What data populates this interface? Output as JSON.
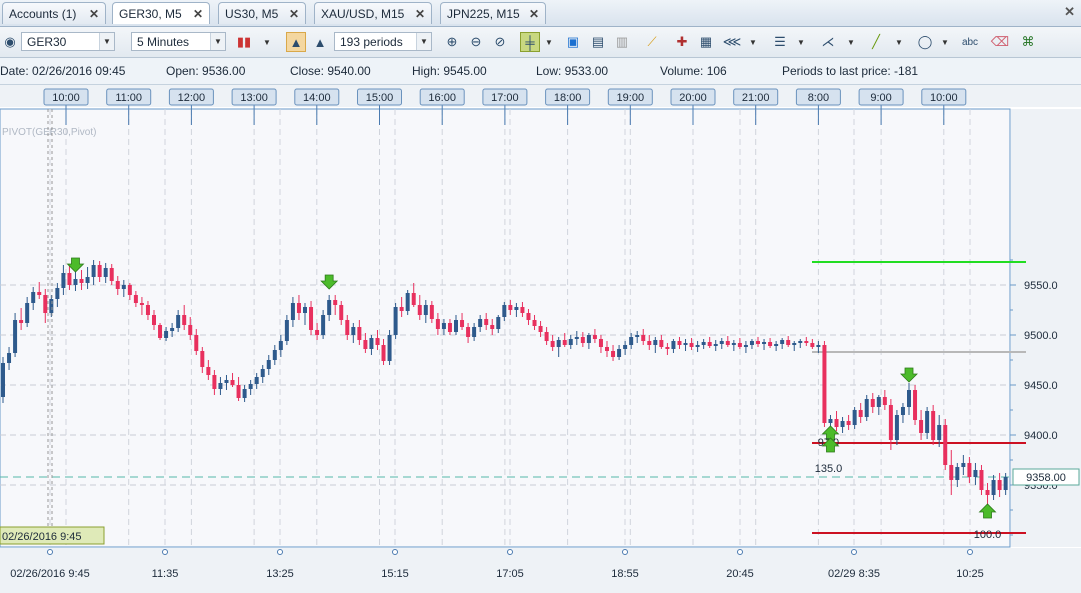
{
  "tabs": [
    {
      "label": "Accounts (1)"
    },
    {
      "label": "GER30, M5"
    },
    {
      "label": "US30, M5"
    },
    {
      "label": "XAU/USD, M15"
    },
    {
      "label": "JPN225, M15"
    }
  ],
  "toolbar": {
    "symbol": "GER30",
    "timeframe": "5 Minutes",
    "periods": "193 periods",
    "text_tool_label": "abc"
  },
  "info": {
    "date": "Date: 02/26/2016 09:45",
    "open": "Open: 9536.00",
    "close": "Close: 9540.00",
    "high": "High: 9545.00",
    "low": "Low: 9533.00",
    "volume": "Volume: 106",
    "periods_to_last": "Periods to last price: -181"
  },
  "colors": {
    "up": "#2e5a8c",
    "down": "#e8305e",
    "green_line": "#22dd22",
    "red_line": "#cc1122",
    "gray_line": "#b8b8b8",
    "current_price_line": "#55b8a8"
  },
  "chart_data": {
    "type": "candlestick",
    "indicator_label": "PIVOT(GER30,Pivot)",
    "y_ticks": [
      "9550.0",
      "9500.0",
      "9450.0",
      "9400.0",
      "9350.0"
    ],
    "y_tick_values": [
      9550,
      9500,
      9450,
      9400,
      9350
    ],
    "current_price": "9358.00",
    "current_price_value": 9358,
    "top_time_labels": [
      "10:00",
      "11:00",
      "12:00",
      "13:00",
      "14:00",
      "15:00",
      "16:00",
      "17:00",
      "18:00",
      "19:00",
      "20:00",
      "21:00",
      "8:00",
      "9:00",
      "10:00"
    ],
    "bottom_time_labels": [
      "02/26/2016 9:45",
      "11:35",
      "13:25",
      "15:15",
      "17:05",
      "18:55",
      "20:45",
      "02/29 8:35",
      "10:25"
    ],
    "crosshair_label": "02/26/2016 9:45",
    "pivot_levels": [
      {
        "name": "green",
        "value": 9573
      },
      {
        "name": "gray",
        "value": 9483
      },
      {
        "name": "red-upper",
        "value": 9392
      },
      {
        "name": "red-lower",
        "value": 9302
      }
    ],
    "markers": [
      {
        "dir": "down",
        "index": 12,
        "price": 9565
      },
      {
        "dir": "down",
        "index": 54,
        "price": 9548
      },
      {
        "dir": "up",
        "index": 137,
        "price": 9405,
        "label": "97.0"
      },
      {
        "dir": "up",
        "index": 137,
        "price": 9393,
        "label": "135.0"
      },
      {
        "dir": "down",
        "index": 150,
        "price": 9455
      },
      {
        "dir": "up",
        "index": 163,
        "price": 9327,
        "label": "100.0"
      }
    ],
    "y_range": [
      9290,
      9600
    ],
    "candles": [
      [
        9438,
        9478,
        9432,
        9472
      ],
      [
        9472,
        9488,
        9465,
        9482
      ],
      [
        9482,
        9522,
        9478,
        9515
      ],
      [
        9515,
        9527,
        9505,
        9512
      ],
      [
        9512,
        9538,
        9508,
        9532
      ],
      [
        9532,
        9548,
        9525,
        9543
      ],
      [
        9543,
        9553,
        9536,
        9540
      ],
      [
        9540,
        9546,
        9512,
        9522
      ],
      [
        9522,
        9540,
        9518,
        9536
      ],
      [
        9536,
        9552,
        9528,
        9547
      ],
      [
        9547,
        9570,
        9540,
        9562
      ],
      [
        9562,
        9570,
        9545,
        9550
      ],
      [
        9550,
        9565,
        9544,
        9556
      ],
      [
        9556,
        9565,
        9545,
        9552
      ],
      [
        9552,
        9568,
        9546,
        9558
      ],
      [
        9558,
        9575,
        9550,
        9570
      ],
      [
        9570,
        9574,
        9553,
        9558
      ],
      [
        9558,
        9572,
        9552,
        9567
      ],
      [
        9567,
        9571,
        9550,
        9554
      ],
      [
        9554,
        9559,
        9540,
        9546
      ],
      [
        9546,
        9555,
        9538,
        9550
      ],
      [
        9550,
        9552,
        9535,
        9540
      ],
      [
        9540,
        9544,
        9528,
        9532
      ],
      [
        9532,
        9538,
        9520,
        9530
      ],
      [
        9530,
        9534,
        9515,
        9520
      ],
      [
        9520,
        9525,
        9505,
        9510
      ],
      [
        9510,
        9512,
        9495,
        9497
      ],
      [
        9497,
        9508,
        9494,
        9504
      ],
      [
        9504,
        9512,
        9498,
        9507
      ],
      [
        9507,
        9525,
        9503,
        9520
      ],
      [
        9520,
        9530,
        9505,
        9510
      ],
      [
        9510,
        9518,
        9495,
        9500
      ],
      [
        9500,
        9506,
        9480,
        9484
      ],
      [
        9484,
        9488,
        9462,
        9468
      ],
      [
        9468,
        9475,
        9455,
        9460
      ],
      [
        9460,
        9465,
        9440,
        9446
      ],
      [
        9446,
        9458,
        9440,
        9452
      ],
      [
        9452,
        9460,
        9445,
        9455
      ],
      [
        9455,
        9462,
        9448,
        9450
      ],
      [
        9450,
        9458,
        9434,
        9437
      ],
      [
        9437,
        9450,
        9433,
        9446
      ],
      [
        9446,
        9455,
        9440,
        9451
      ],
      [
        9451,
        9462,
        9446,
        9458
      ],
      [
        9458,
        9470,
        9452,
        9466
      ],
      [
        9466,
        9480,
        9460,
        9475
      ],
      [
        9475,
        9490,
        9470,
        9485
      ],
      [
        9485,
        9500,
        9478,
        9494
      ],
      [
        9494,
        9520,
        9490,
        9515
      ],
      [
        9515,
        9538,
        9508,
        9532
      ],
      [
        9532,
        9540,
        9515,
        9522
      ],
      [
        9522,
        9532,
        9510,
        9528
      ],
      [
        9528,
        9534,
        9500,
        9505
      ],
      [
        9505,
        9512,
        9495,
        9500
      ],
      [
        9500,
        9525,
        9496,
        9520
      ],
      [
        9520,
        9540,
        9514,
        9535
      ],
      [
        9535,
        9540,
        9520,
        9530
      ],
      [
        9530,
        9534,
        9510,
        9515
      ],
      [
        9515,
        9520,
        9495,
        9500
      ],
      [
        9500,
        9512,
        9492,
        9508
      ],
      [
        9508,
        9515,
        9490,
        9495
      ],
      [
        9495,
        9502,
        9482,
        9486
      ],
      [
        9486,
        9500,
        9480,
        9497
      ],
      [
        9497,
        9505,
        9485,
        9490
      ],
      [
        9490,
        9496,
        9470,
        9474
      ],
      [
        9474,
        9505,
        9470,
        9500
      ],
      [
        9500,
        9532,
        9496,
        9528
      ],
      [
        9528,
        9538,
        9518,
        9524
      ],
      [
        9524,
        9545,
        9520,
        9542
      ],
      [
        9542,
        9552,
        9528,
        9530
      ],
      [
        9530,
        9540,
        9515,
        9520
      ],
      [
        9520,
        9535,
        9512,
        9530
      ],
      [
        9530,
        9534,
        9512,
        9516
      ],
      [
        9516,
        9522,
        9500,
        9506
      ],
      [
        9506,
        9516,
        9500,
        9512
      ],
      [
        9512,
        9516,
        9500,
        9503
      ],
      [
        9503,
        9520,
        9500,
        9515
      ],
      [
        9515,
        9522,
        9505,
        9508
      ],
      [
        9508,
        9512,
        9492,
        9498
      ],
      [
        9498,
        9512,
        9494,
        9508
      ],
      [
        9508,
        9520,
        9503,
        9516
      ],
      [
        9516,
        9522,
        9505,
        9510
      ],
      [
        9510,
        9516,
        9500,
        9506
      ],
      [
        9506,
        9520,
        9502,
        9518
      ],
      [
        9518,
        9533,
        9514,
        9530
      ],
      [
        9530,
        9535,
        9520,
        9525
      ],
      [
        9525,
        9532,
        9518,
        9528
      ],
      [
        9528,
        9533,
        9518,
        9522
      ],
      [
        9522,
        9526,
        9510,
        9515
      ],
      [
        9515,
        9520,
        9505,
        9509
      ],
      [
        9509,
        9514,
        9498,
        9503
      ],
      [
        9503,
        9508,
        9490,
        9494
      ],
      [
        9494,
        9500,
        9484,
        9488
      ],
      [
        9488,
        9498,
        9478,
        9495
      ],
      [
        9495,
        9502,
        9488,
        9490
      ],
      [
        9490,
        9500,
        9486,
        9496
      ],
      [
        9496,
        9504,
        9490,
        9498
      ],
      [
        9498,
        9503,
        9488,
        9492
      ],
      [
        9492,
        9502,
        9486,
        9500
      ],
      [
        9500,
        9506,
        9492,
        9496
      ],
      [
        9496,
        9500,
        9482,
        9488
      ],
      [
        9488,
        9494,
        9478,
        9484
      ],
      [
        9484,
        9490,
        9474,
        9478
      ],
      [
        9478,
        9490,
        9475,
        9486
      ],
      [
        9486,
        9494,
        9480,
        9490
      ],
      [
        9490,
        9502,
        9486,
        9498
      ],
      [
        9498,
        9504,
        9492,
        9500
      ],
      [
        9500,
        9506,
        9490,
        9494
      ],
      [
        9494,
        9500,
        9485,
        9490
      ],
      [
        9490,
        9498,
        9482,
        9495
      ],
      [
        9495,
        9500,
        9486,
        9488
      ],
      [
        9488,
        9492,
        9480,
        9486
      ],
      [
        9486,
        9496,
        9482,
        9494
      ],
      [
        9494,
        9498,
        9486,
        9490
      ],
      [
        9490,
        9496,
        9484,
        9492
      ],
      [
        9492,
        9497,
        9485,
        9488
      ],
      [
        9488,
        9494,
        9483,
        9490
      ],
      [
        9490,
        9496,
        9486,
        9493
      ],
      [
        9493,
        9498,
        9487,
        9489
      ],
      [
        9489,
        9495,
        9484,
        9491
      ],
      [
        9491,
        9497,
        9486,
        9494
      ],
      [
        9494,
        9499,
        9488,
        9490
      ],
      [
        9490,
        9495,
        9484,
        9492
      ],
      [
        9492,
        9497,
        9486,
        9488
      ],
      [
        9488,
        9494,
        9482,
        9490
      ],
      [
        9490,
        9496,
        9486,
        9494
      ],
      [
        9494,
        9498,
        9488,
        9491
      ],
      [
        9491,
        9496,
        9485,
        9493
      ],
      [
        9493,
        9497,
        9487,
        9489
      ],
      [
        9489,
        9494,
        9484,
        9491
      ],
      [
        9491,
        9497,
        9486,
        9495
      ],
      [
        9495,
        9499,
        9488,
        9490
      ],
      [
        9490,
        9494,
        9484,
        9492
      ],
      [
        9492,
        9496,
        9487,
        9494
      ],
      [
        9494,
        9498,
        9489,
        9492
      ],
      [
        9492,
        9496,
        9486,
        9488
      ],
      [
        9488,
        9494,
        9482,
        9490
      ],
      [
        9490,
        9494,
        9408,
        9412
      ],
      [
        9412,
        9420,
        9402,
        9416
      ],
      [
        9416,
        9424,
        9404,
        9408
      ],
      [
        9408,
        9418,
        9402,
        9414
      ],
      [
        9414,
        9420,
        9405,
        9410
      ],
      [
        9410,
        9428,
        9406,
        9425
      ],
      [
        9425,
        9432,
        9412,
        9418
      ],
      [
        9418,
        9440,
        9414,
        9436
      ],
      [
        9436,
        9442,
        9422,
        9428
      ],
      [
        9428,
        9440,
        9420,
        9438
      ],
      [
        9438,
        9445,
        9425,
        9430
      ],
      [
        9430,
        9436,
        9385,
        9395
      ],
      [
        9395,
        9425,
        9390,
        9420
      ],
      [
        9420,
        9432,
        9412,
        9428
      ],
      [
        9428,
        9452,
        9420,
        9445
      ],
      [
        9445,
        9450,
        9410,
        9415
      ],
      [
        9415,
        9425,
        9395,
        9402
      ],
      [
        9402,
        9428,
        9396,
        9424
      ],
      [
        9424,
        9430,
        9390,
        9395
      ],
      [
        9395,
        9420,
        9388,
        9410
      ],
      [
        9410,
        9416,
        9365,
        9370
      ],
      [
        9370,
        9385,
        9340,
        9355
      ],
      [
        9355,
        9372,
        9348,
        9368
      ],
      [
        9368,
        9380,
        9360,
        9372
      ],
      [
        9372,
        9378,
        9352,
        9358
      ],
      [
        9358,
        9372,
        9350,
        9365
      ],
      [
        9365,
        9370,
        9340,
        9345
      ],
      [
        9345,
        9352,
        9325,
        9340
      ],
      [
        9340,
        9360,
        9335,
        9355
      ],
      [
        9355,
        9362,
        9338,
        9345
      ],
      [
        9345,
        9362,
        9340,
        9358
      ]
    ]
  }
}
